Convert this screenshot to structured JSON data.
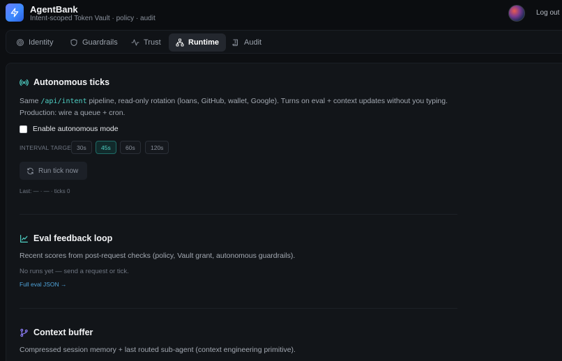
{
  "app": {
    "name": "AgentBank",
    "subtitle": "Intent-scoped Token Vault · policy · audit",
    "logout_label": "Log out"
  },
  "tabs": [
    {
      "label": "Identity",
      "icon": "fingerprint-icon",
      "active": false
    },
    {
      "label": "Guardrails",
      "icon": "shield-icon",
      "active": false
    },
    {
      "label": "Trust",
      "icon": "pulse-icon",
      "active": false
    },
    {
      "label": "Runtime",
      "icon": "network-icon",
      "active": true
    },
    {
      "label": "Audit",
      "icon": "scroll-icon",
      "active": false
    }
  ],
  "autonomous": {
    "title": "Autonomous ticks",
    "desc_prefix": "Same ",
    "desc_code": "/api/intent",
    "desc_rest": " pipeline, read-only rotation (loans, GitHub, wallet, Google). Turns on eval + context updates without you typing.",
    "desc_line2": "Production: wire a queue + cron.",
    "checkbox_label": "Enable autonomous mode",
    "checkbox_checked": false,
    "interval_label": "INTERVAL TARGET",
    "intervals": [
      "30s",
      "45s",
      "60s",
      "120s"
    ],
    "selected_interval": "45s",
    "run_button": "Run tick now",
    "last_status": "Last: — · — · ticks 0"
  },
  "eval": {
    "title": "Eval feedback loop",
    "desc": "Recent scores from post-request checks (policy, Vault grant, autonomous guardrails).",
    "empty": "No runs yet — send a request or tick.",
    "link": "Full eval JSON →"
  },
  "context": {
    "title": "Context buffer",
    "desc": "Compressed session memory + last routed sub-agent (context engineering primitive)."
  },
  "colors": {
    "accent": "#4fd1c5",
    "brand_gradient_start": "#6a7cff",
    "brand_gradient_end": "#2b5ee0",
    "link": "#4fa3d9",
    "background": "#0d0f12"
  }
}
